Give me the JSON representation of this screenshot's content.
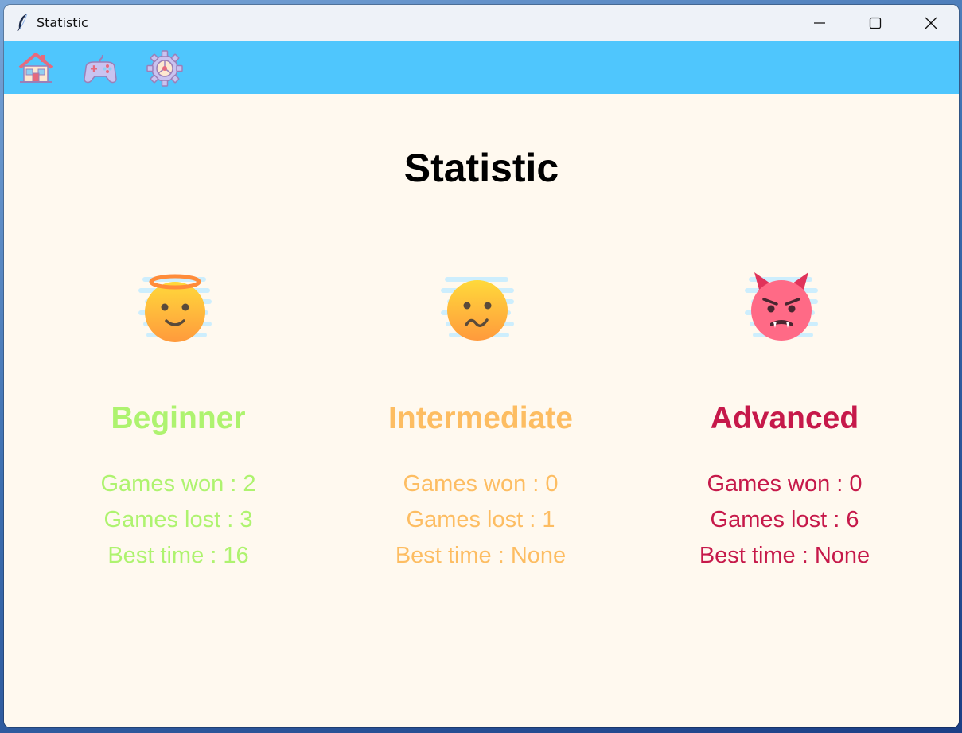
{
  "window": {
    "title": "Statistic"
  },
  "toolbar": {
    "items": [
      {
        "icon": "home-icon"
      },
      {
        "icon": "gamepad-icon"
      },
      {
        "icon": "settings-gear-icon"
      }
    ],
    "background": "#4fc6fd"
  },
  "page": {
    "title": "Statistic",
    "background": "#fff9ef"
  },
  "levels": [
    {
      "icon": "angel-face-icon",
      "name": "Beginner",
      "color": "#aef36f",
      "games_won": "Games won : 2",
      "games_lost": "Games lost : 3",
      "best_time": "Best time : 16"
    },
    {
      "icon": "confused-face-icon",
      "name": "Intermediate",
      "color": "#fdbd62",
      "games_won": "Games won : 0",
      "games_lost": "Games lost : 1",
      "best_time": "Best time : None"
    },
    {
      "icon": "devil-face-icon",
      "name": "Advanced",
      "color": "#c6194a",
      "games_won": "Games won : 0",
      "games_lost": "Games lost : 6",
      "best_time": "Best time : None"
    }
  ]
}
